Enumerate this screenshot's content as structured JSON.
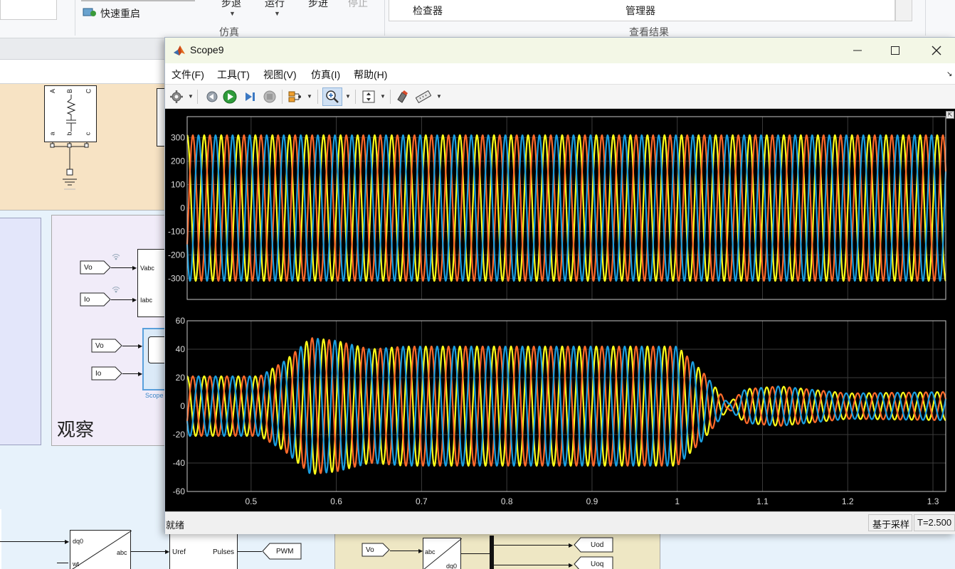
{
  "ribbon": {
    "fast_restart": "快速重启",
    "step_back": "步退",
    "run": "运行",
    "step_forward": "步进",
    "stop": "停止",
    "simulation_group": "仿真",
    "inspector": "检查器",
    "manager": "管理器",
    "review_group": "查看结果"
  },
  "model": {
    "observe_label": "观察",
    "vo": "Vo",
    "io": "Io",
    "vabc": "Vabc",
    "iabc": "Iabc",
    "scope_label": "Scope",
    "dq0": "dq0",
    "wt": "wt",
    "abc": "abc",
    "uref": "Uref",
    "pulses": "Pulses",
    "pwm": "PWM",
    "uod": "Uod",
    "uoq": "Uoq",
    "pin_a_top": "A",
    "pin_b_top": "B",
    "pin_c_top": "C",
    "pin_a_bot": "a",
    "pin_b_bot": "b",
    "pin_c_bot": "c"
  },
  "scope": {
    "title": "Scope9",
    "menu": [
      "文件(F)",
      "工具(T)",
      "视图(V)",
      "仿真(I)",
      "帮助(H)"
    ],
    "toolbar_icons": [
      "gear-icon",
      "step-back-icon",
      "run-icon",
      "step-forward-icon",
      "stop-icon",
      "signal-select-icon",
      "zoom-in-icon",
      "autoscale-icon",
      "highlight-icon",
      "measure-icon"
    ],
    "status": "就绪",
    "sample_mode": "基于采样",
    "time": "T=2.500",
    "colors": {
      "phase_a": "#ffff1a",
      "phase_b": "#ff6a2a",
      "phase_c": "#1a9ee0",
      "grid": "#3c3c3c",
      "axis": "#c8c8c8"
    }
  },
  "chart_data": [
    {
      "type": "line",
      "title": "",
      "xlabel": "",
      "ylabel": "",
      "xlim": [
        0.425,
        1.315
      ],
      "ylim": [
        -390,
        390
      ],
      "yticks": [
        -300,
        -200,
        -100,
        0,
        100,
        200,
        300
      ],
      "xticks": [],
      "grid": true,
      "legend": "none",
      "frequency_hz": 50,
      "series": [
        {
          "color": "#ffff1a",
          "amplitude": [
            [
              0.425,
              311
            ],
            [
              1.315,
              311
            ]
          ],
          "phase_deg": 0
        },
        {
          "color": "#ff6a2a",
          "amplitude": [
            [
              0.425,
              311
            ],
            [
              1.315,
              311
            ]
          ],
          "phase_deg": -120
        },
        {
          "color": "#1a9ee0",
          "amplitude": [
            [
              0.425,
              311
            ],
            [
              1.315,
              311
            ]
          ],
          "phase_deg": 120
        }
      ]
    },
    {
      "type": "line",
      "title": "",
      "xlabel": "",
      "ylabel": "",
      "xlim": [
        0.425,
        1.315
      ],
      "ylim": [
        -60,
        60
      ],
      "yticks": [
        -60,
        -40,
        -20,
        0,
        20,
        40,
        60
      ],
      "xticks": [
        0.5,
        0.6,
        0.7,
        0.8,
        0.9,
        1,
        1.1,
        1.2,
        1.3
      ],
      "grid": true,
      "legend": "none",
      "frequency_hz": 50,
      "series": [
        {
          "color": "#ffff1a",
          "phase_deg": 0,
          "amplitude": [
            [
              0.425,
              21
            ],
            [
              0.51,
              21
            ],
            [
              0.54,
              32
            ],
            [
              0.57,
              48
            ],
            [
              0.6,
              46
            ],
            [
              0.64,
              40
            ],
            [
              0.68,
              42
            ],
            [
              1.0,
              42
            ],
            [
              1.03,
              24
            ],
            [
              1.06,
              2
            ],
            [
              1.08,
              12
            ],
            [
              1.12,
              14
            ],
            [
              1.2,
              9
            ],
            [
              1.315,
              10
            ]
          ]
        },
        {
          "color": "#ff6a2a",
          "phase_deg": -120,
          "amplitude": [
            [
              0.425,
              21
            ],
            [
              0.51,
              21
            ],
            [
              0.54,
              32
            ],
            [
              0.57,
              48
            ],
            [
              0.6,
              46
            ],
            [
              0.64,
              40
            ],
            [
              0.68,
              42
            ],
            [
              1.0,
              42
            ],
            [
              1.03,
              24
            ],
            [
              1.06,
              2
            ],
            [
              1.08,
              12
            ],
            [
              1.12,
              14
            ],
            [
              1.2,
              9
            ],
            [
              1.315,
              10
            ]
          ]
        },
        {
          "color": "#1a9ee0",
          "phase_deg": 120,
          "amplitude": [
            [
              0.425,
              21
            ],
            [
              0.51,
              21
            ],
            [
              0.54,
              32
            ],
            [
              0.57,
              48
            ],
            [
              0.6,
              46
            ],
            [
              0.64,
              40
            ],
            [
              0.68,
              42
            ],
            [
              1.0,
              42
            ],
            [
              1.03,
              24
            ],
            [
              1.06,
              2
            ],
            [
              1.08,
              12
            ],
            [
              1.12,
              14
            ],
            [
              1.2,
              9
            ],
            [
              1.315,
              10
            ]
          ]
        }
      ]
    }
  ]
}
